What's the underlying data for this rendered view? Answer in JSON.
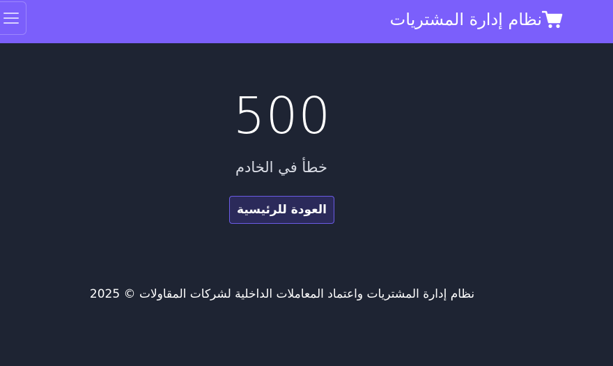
{
  "header": {
    "brand_text": "نظام إدارة المشتريات",
    "brand_icon": "shopping-cart-icon",
    "menu_icon": "hamburger-menu-icon"
  },
  "error": {
    "code": "500",
    "message": "خطأ في الخادم"
  },
  "actions": {
    "home_label": "العودة للرئيسية"
  },
  "footer": {
    "text": "نظام إدارة المشتريات واعتماد المعاملات الداخلية لشركات المقاولات © 2025"
  },
  "colors": {
    "navbar": "#7b5ffb",
    "background": "#1e2433",
    "button_bg": "#2b2a5a",
    "button_border": "#6c5ce7"
  }
}
